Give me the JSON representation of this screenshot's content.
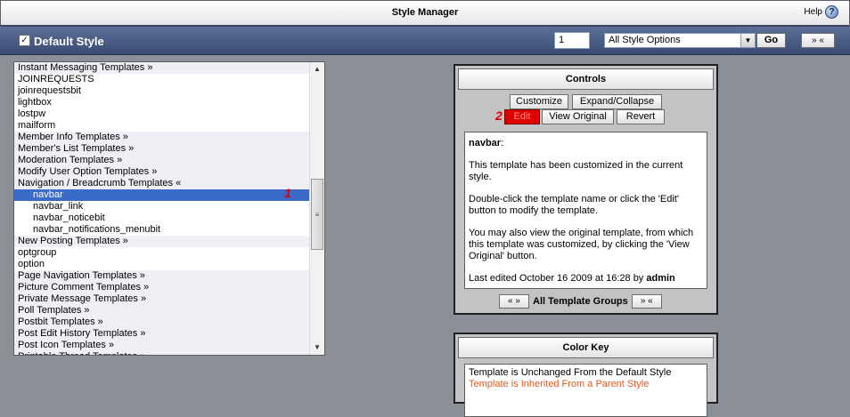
{
  "header": {
    "title": "Style Manager",
    "help_label": "Help",
    "help_icon": "question-mark-icon"
  },
  "style_bar": {
    "style_checked": true,
    "style_name": "Default Style",
    "page_number": "1",
    "options_select": "All Style Options",
    "go_label": "Go",
    "expand_label": "» «"
  },
  "template_list": {
    "items": [
      {
        "label": "Instant Messaging Templates »",
        "kind": "group"
      },
      {
        "label": "JOINREQUESTS",
        "kind": "item"
      },
      {
        "label": "joinrequestsbit",
        "kind": "item"
      },
      {
        "label": "lightbox",
        "kind": "item"
      },
      {
        "label": "lostpw",
        "kind": "item"
      },
      {
        "label": "mailform",
        "kind": "item"
      },
      {
        "label": "Member Info Templates »",
        "kind": "group"
      },
      {
        "label": "Member's List Templates »",
        "kind": "group"
      },
      {
        "label": "Moderation Templates »",
        "kind": "group"
      },
      {
        "label": "Modify User Option Templates »",
        "kind": "group"
      },
      {
        "label": "Navigation / Breadcrumb Templates «",
        "kind": "group-open"
      },
      {
        "label": "navbar",
        "kind": "child-selected"
      },
      {
        "label": "navbar_link",
        "kind": "child"
      },
      {
        "label": "navbar_noticebit",
        "kind": "child"
      },
      {
        "label": "navbar_notifications_menubit",
        "kind": "child"
      },
      {
        "label": "New Posting Templates »",
        "kind": "group"
      },
      {
        "label": "optgroup",
        "kind": "item"
      },
      {
        "label": "option",
        "kind": "item"
      },
      {
        "label": "Page Navigation Templates »",
        "kind": "group"
      },
      {
        "label": "Picture Comment Templates »",
        "kind": "group"
      },
      {
        "label": "Private Message Templates »",
        "kind": "group"
      },
      {
        "label": "Poll Templates »",
        "kind": "group"
      },
      {
        "label": "Postbit Templates »",
        "kind": "group"
      },
      {
        "label": "Post Edit History Templates »",
        "kind": "group"
      },
      {
        "label": "Post Icon Templates »",
        "kind": "group"
      },
      {
        "label": "Printable Thread Templates »",
        "kind": "group"
      }
    ],
    "annotation_1": "1"
  },
  "controls": {
    "title": "Controls",
    "customize_label": "Customize",
    "expand_collapse_label": "Expand/Collapse",
    "edit_label": "Edit",
    "view_original_label": "View Original",
    "revert_label": "Revert",
    "annotation_2": "2",
    "template_name": "navbar",
    "template_name_suffix": ":",
    "desc_1": "This template has been customized in the current style.",
    "desc_2": "Double-click the template name or click the 'Edit' button to modify the template.",
    "desc_3": "You may also view the original template, from which this template was customized, by clicking the 'View Original' button.",
    "last_edited_prefix": "Last edited October 16 2009 at 16:28 by",
    "last_edited_user": "admin",
    "prev_group_label": "« »",
    "all_groups_label": "All Template Groups",
    "next_group_label": "» «"
  },
  "color_key": {
    "title": "Color Key",
    "unchanged": "Template is Unchanged From the Default Style",
    "inherited": "Template is Inherited From a Parent Style"
  },
  "colors": {
    "accent_bar": "#3a4c73",
    "selection": "#3c6ac9",
    "edit_button": "#e00000",
    "inherited_text": "#e05a1e"
  }
}
